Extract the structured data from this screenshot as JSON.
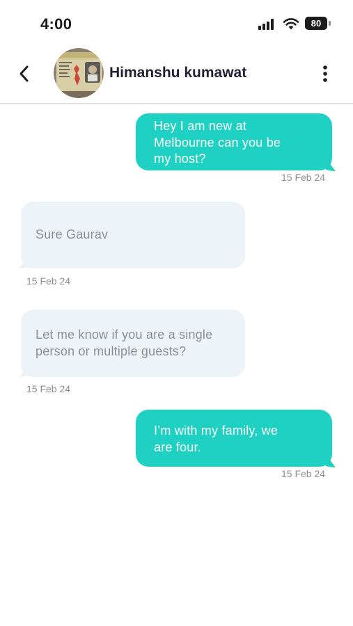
{
  "status_bar": {
    "time": "4:00",
    "battery": "80"
  },
  "header": {
    "contact_name": "Himanshu kumawat"
  },
  "messages": [
    {
      "direction": "outgoing",
      "lines": [
        "Hey I am new at",
        "Melbourne can you be",
        "my host?"
      ],
      "date": "15 Feb 24"
    },
    {
      "direction": "incoming",
      "lines": [
        "Sure Gaurav"
      ],
      "date": "15 Feb 24"
    },
    {
      "direction": "incoming",
      "lines": [
        "Let me know if you are a single",
        "person or multiple guests?"
      ],
      "date": "15 Feb 24"
    },
    {
      "direction": "outgoing",
      "lines": [
        "I’m with my family, we",
        "are four."
      ],
      "date": "15 Feb 24"
    }
  ],
  "colors": {
    "outgoing_bubble": "#1fd1c2",
    "incoming_bubble": "#eef3f8",
    "incoming_text": "#8a8f99"
  },
  "icons": [
    "back-chevron-icon",
    "more-vertical-icon",
    "signal-icon",
    "wifi-icon",
    "battery-icon"
  ]
}
